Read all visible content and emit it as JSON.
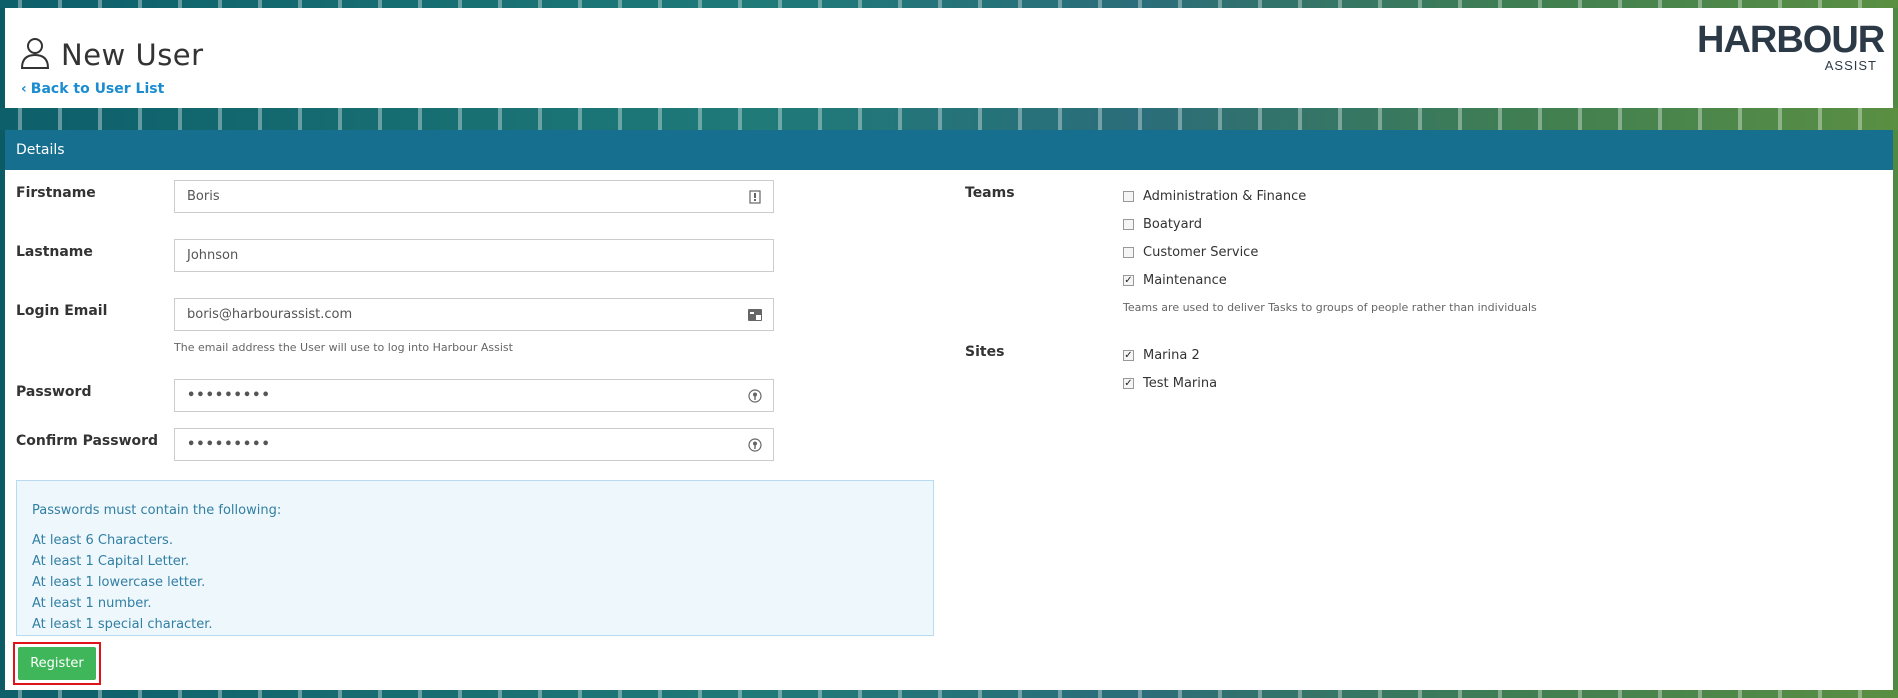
{
  "header": {
    "title": "New User",
    "back_link": "Back to User List",
    "logo_main": "HARBOUR",
    "logo_sub": "ASSIST"
  },
  "details": {
    "section_title": "Details",
    "fields": {
      "firstname": {
        "label": "Firstname",
        "value": "Boris"
      },
      "lastname": {
        "label": "Lastname",
        "value": "Johnson"
      },
      "login_email": {
        "label": "Login Email",
        "value": "boris@harbourassist.com",
        "help": "The email address the User will use to log into Harbour Assist"
      },
      "password": {
        "label": "Password",
        "value": "•••••••••"
      },
      "confirm_password": {
        "label": "Confirm Password",
        "value": "•••••••••"
      }
    },
    "password_rules": {
      "intro": "Passwords must contain the following:",
      "rules": [
        "At least 6 Characters.",
        "At least 1 Capital Letter.",
        "At least 1 lowercase letter.",
        "At least 1 number.",
        "At least 1 special character."
      ]
    },
    "register_label": "Register",
    "teams": {
      "label": "Teams",
      "items": [
        {
          "label": "Administration & Finance",
          "checked": false
        },
        {
          "label": "Boatyard",
          "checked": false
        },
        {
          "label": "Customer Service",
          "checked": false
        },
        {
          "label": "Maintenance",
          "checked": true
        }
      ],
      "help": "Teams are used to deliver Tasks to groups of people rather than individuals"
    },
    "sites": {
      "label": "Sites",
      "items": [
        {
          "label": "Marina 2",
          "checked": true
        },
        {
          "label": "Test Marina",
          "checked": true
        }
      ]
    }
  },
  "colors": {
    "header_bar": "#166f8f",
    "link": "#1a8ccf",
    "register": "#3fb65a",
    "highlight": "#e0131b"
  }
}
